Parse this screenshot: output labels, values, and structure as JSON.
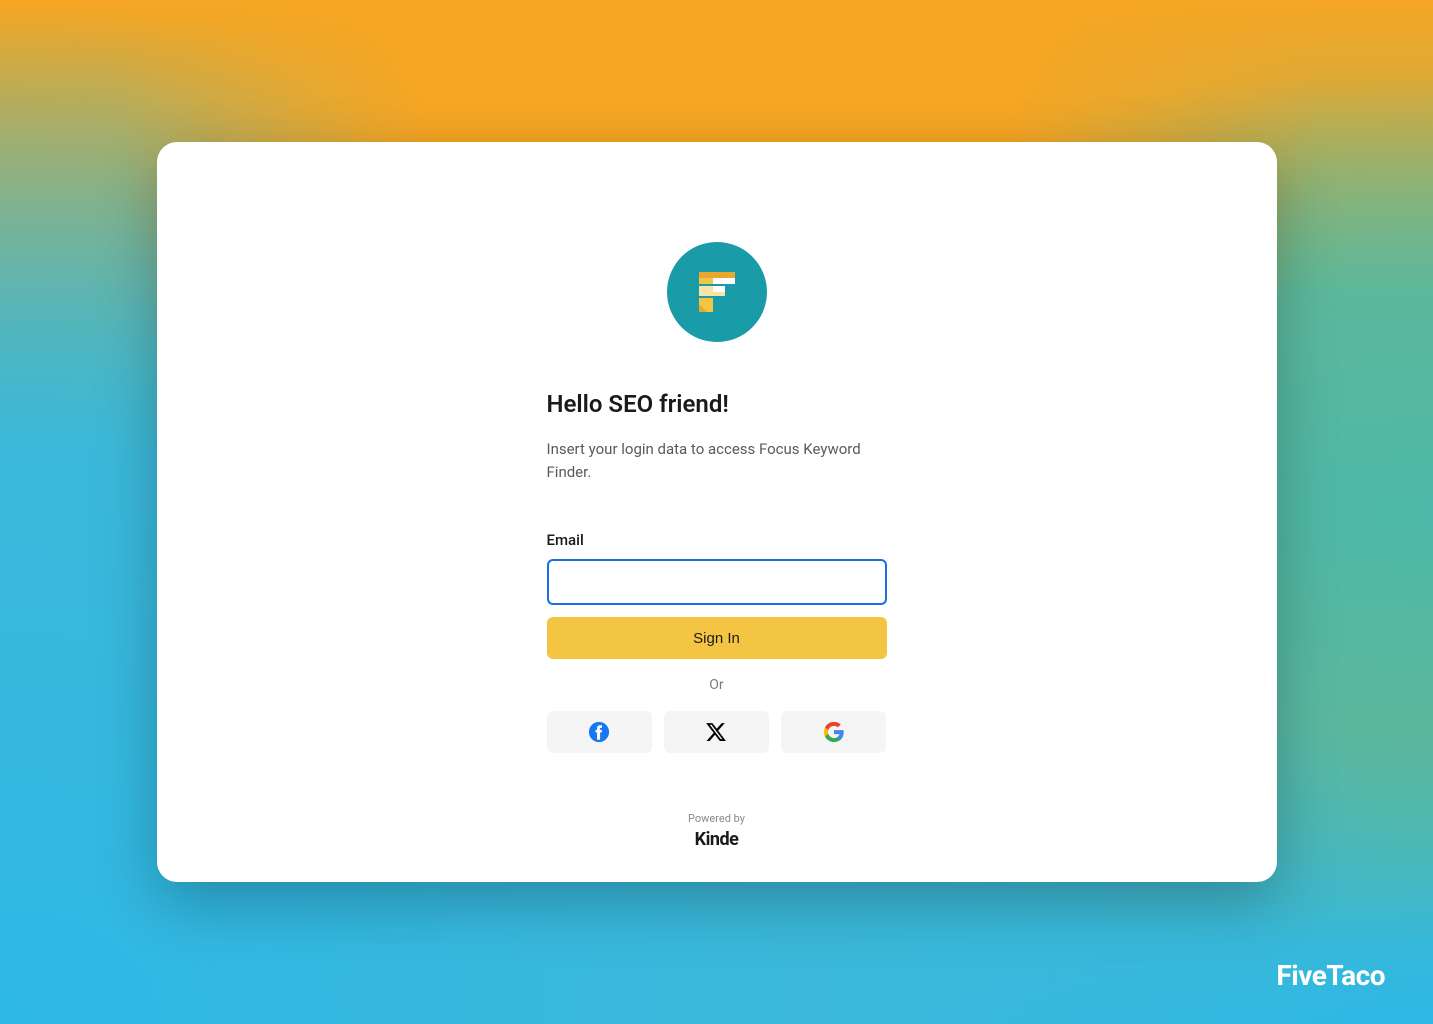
{
  "heading": "Hello SEO friend!",
  "subheading": "Insert your login data to access Focus Keyword Finder.",
  "form": {
    "email_label": "Email",
    "email_value": "",
    "signin_label": "Sign In",
    "divider_label": "Or"
  },
  "social": {
    "facebook_name": "facebook-icon",
    "x_name": "x-icon",
    "google_name": "google-icon"
  },
  "footer": {
    "powered_by": "Powered by",
    "provider": "Kinde"
  },
  "watermark": "FiveTaco"
}
